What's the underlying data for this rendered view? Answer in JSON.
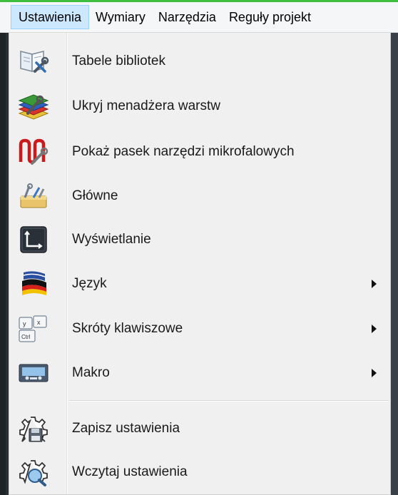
{
  "menubar": {
    "items": [
      "Ustawienia",
      "Wymiary",
      "Narzędzia",
      "Reguły projekt"
    ]
  },
  "menu": {
    "items": [
      {
        "label": "Tabele bibliotek",
        "icon": "library-tables-icon",
        "submenu": false
      },
      {
        "label": "Ukryj menadżera warstw",
        "icon": "layer-manager-icon",
        "submenu": false
      },
      {
        "label": "Pokaż pasek narzędzi mikrofalowych",
        "icon": "microwave-toolbar-icon",
        "submenu": false
      },
      {
        "label": "Główne",
        "icon": "main-settings-icon",
        "submenu": false
      },
      {
        "label": "Wyświetlanie",
        "icon": "display-icon",
        "submenu": false
      },
      {
        "label": "Język",
        "icon": "language-flag-icon",
        "submenu": true
      },
      {
        "label": "Skróty klawiszowe",
        "icon": "keyboard-shortcuts-icon",
        "submenu": true
      },
      {
        "label": "Makro",
        "icon": "macro-cassette-icon",
        "submenu": true
      },
      {
        "label": "Zapisz ustawienia",
        "icon": "save-settings-icon",
        "submenu": false
      },
      {
        "label": "Wczytaj ustawienia",
        "icon": "load-settings-icon",
        "submenu": false
      }
    ]
  },
  "colors": {
    "menu_bg": "#f0f0f0",
    "active_highlight": "#cce8ff",
    "active_border": "#99d1ff",
    "top_strip": "#3fbf3f"
  }
}
